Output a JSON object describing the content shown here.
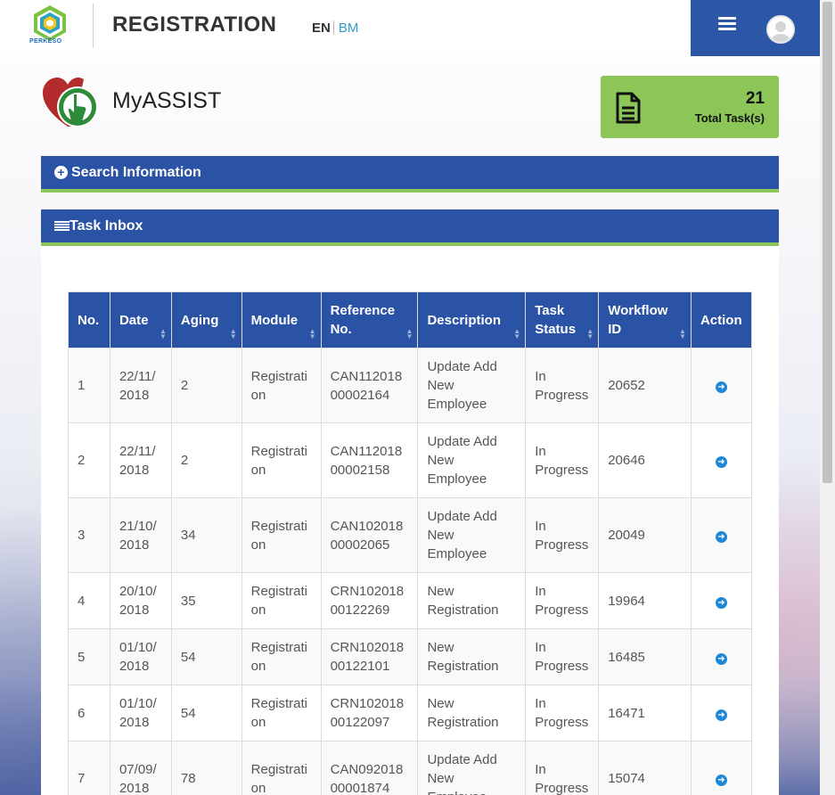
{
  "header": {
    "logo_text": "PERKESO",
    "title": "REGISTRATION",
    "lang_en": "EN",
    "lang_bm": "BM"
  },
  "assist": {
    "title": "MyASSIST",
    "task_count": "21",
    "task_label": "Total Task(s)"
  },
  "panels": {
    "search": "Search Information",
    "inbox": "Task Inbox"
  },
  "table": {
    "columns": [
      "No.",
      "Date",
      "Aging",
      "Module",
      "Reference No.",
      "Description",
      "Task Status",
      "Workflow ID",
      "Action"
    ],
    "rows": [
      {
        "no": "1",
        "date": "22/11/ 2018",
        "aging": "2",
        "module": "Registrati on",
        "ref": "CAN112018 00002164",
        "desc": "Update Add New Employee",
        "status": "In Progress",
        "wf": "20652"
      },
      {
        "no": "2",
        "date": "22/11/ 2018",
        "aging": "2",
        "module": "Registrati on",
        "ref": "CAN112018 00002158",
        "desc": "Update Add New Employee",
        "status": "In Progress",
        "wf": "20646"
      },
      {
        "no": "3",
        "date": "21/10/ 2018",
        "aging": "34",
        "module": "Registrati on",
        "ref": "CAN102018 00002065",
        "desc": "Update Add New Employee",
        "status": "In Progress",
        "wf": "20049"
      },
      {
        "no": "4",
        "date": "20/10/ 2018",
        "aging": "35",
        "module": "Registrati on",
        "ref": "CRN102018 00122269",
        "desc": "New Registration",
        "status": "In Progress",
        "wf": "19964"
      },
      {
        "no": "5",
        "date": "01/10/ 2018",
        "aging": "54",
        "module": "Registrati on",
        "ref": "CRN102018 00122101",
        "desc": "New Registration",
        "status": "In Progress",
        "wf": "16485"
      },
      {
        "no": "6",
        "date": "01/10/ 2018",
        "aging": "54",
        "module": "Registrati on",
        "ref": "CRN102018 00122097",
        "desc": "New Registration",
        "status": "In Progress",
        "wf": "16471"
      },
      {
        "no": "7",
        "date": "07/09/ 2018",
        "aging": "78",
        "module": "Registrati on",
        "ref": "CAN092018 00001874",
        "desc": "Update Add New Employee",
        "status": "In Progress",
        "wf": "15074"
      }
    ]
  },
  "colors": {
    "primary": "#2b53a5",
    "accent_green": "#8cc659",
    "link_blue": "#1e88d6"
  }
}
